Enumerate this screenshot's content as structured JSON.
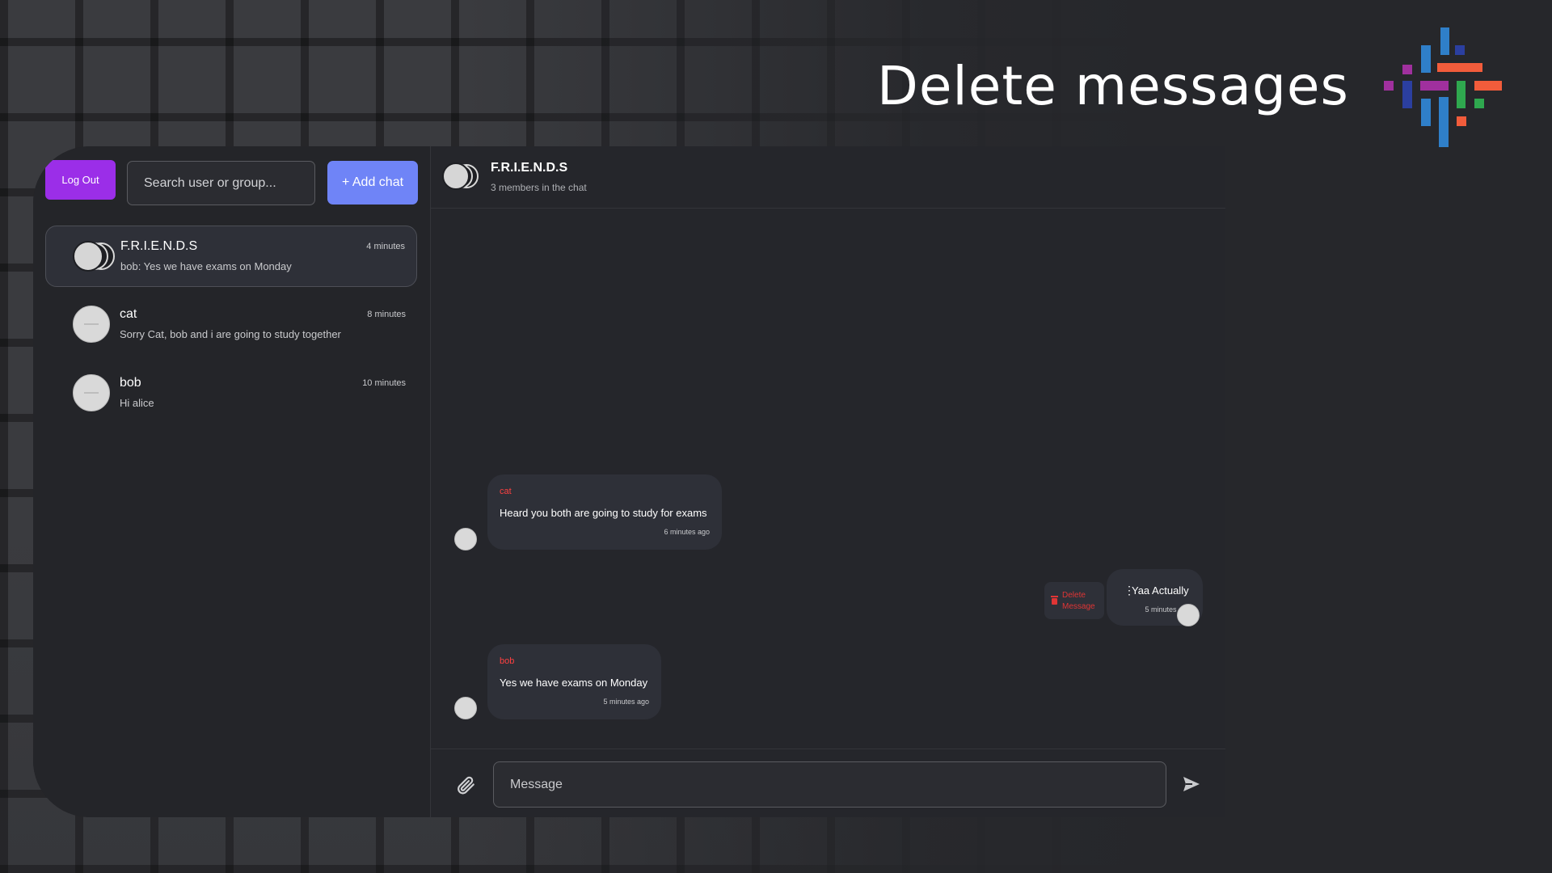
{
  "slide": {
    "title": "Delete messages"
  },
  "sidebar": {
    "logout_label": "Log Out",
    "search_placeholder": "Search user or group...",
    "add_chat_label": "+ Add chat",
    "chats": [
      {
        "name": "F.R.I.E.N.D.S",
        "preview": "bob: Yes we have exams on Monday",
        "time": "4 minutes",
        "type": "group"
      },
      {
        "name": "cat",
        "preview": "Sorry Cat, bob and i are going to study together",
        "time": "8 minutes",
        "type": "direct"
      },
      {
        "name": "bob",
        "preview": "Hi alice",
        "time": "10 minutes",
        "type": "direct"
      }
    ]
  },
  "chat": {
    "title": "F.R.I.E.N.D.S",
    "subtitle": "3 members in the chat",
    "messages": [
      {
        "sender": "cat",
        "text": "Heard you both are going to study for exams",
        "time": "6 minutes ago",
        "own": false
      },
      {
        "sender": "",
        "text": "Yaa Actually",
        "time": "5 minutes ago",
        "own": true
      },
      {
        "sender": "bob",
        "text": "Yes we have exams on Monday",
        "time": "5 minutes ago",
        "own": false
      }
    ],
    "delete_label": "Delete Message",
    "input_placeholder": "Message"
  },
  "colors": {
    "logout": "#9b2ee8",
    "add_chat": "#6f84f7",
    "sender_name": "#ff4040",
    "delete": "#e03535"
  },
  "icons": [
    "paperclip-icon",
    "send-icon",
    "trash-icon",
    "more-vertical-icon",
    "logo-icon"
  ]
}
